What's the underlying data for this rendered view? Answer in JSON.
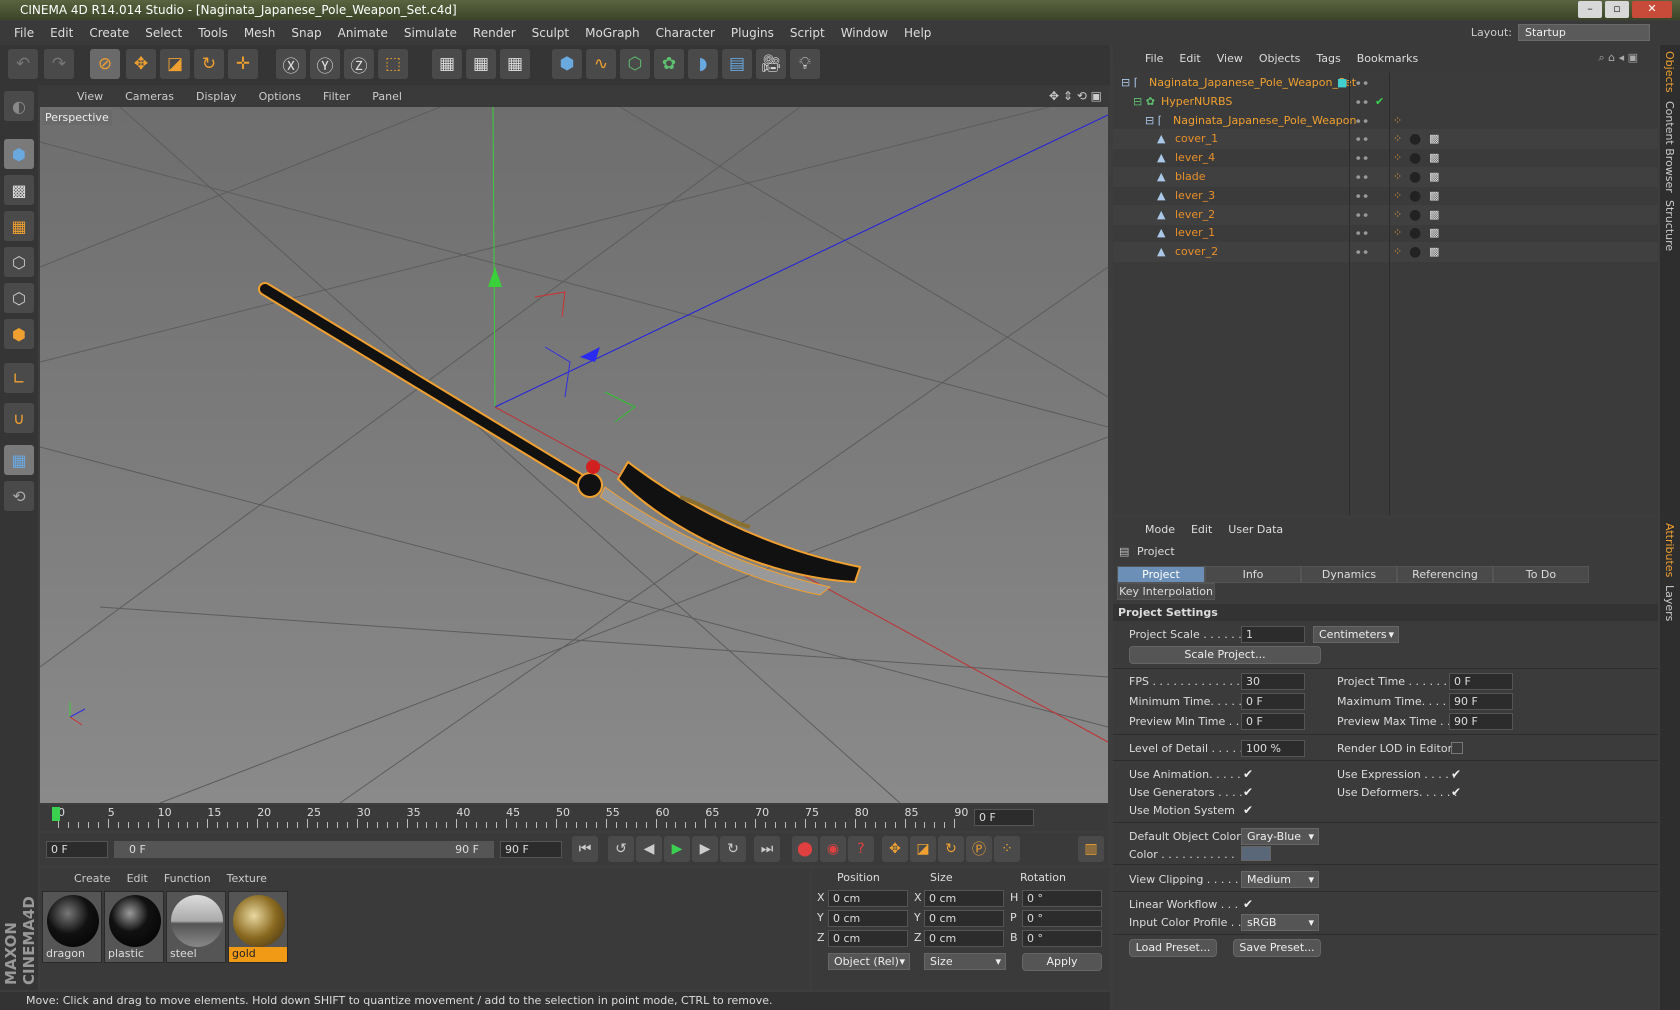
{
  "window": {
    "title": "CINEMA 4D R14.014 Studio - [Naginata_Japanese_Pole_Weapon_Set.c4d]"
  },
  "menubar": {
    "items": [
      "File",
      "Edit",
      "Create",
      "Select",
      "Tools",
      "Mesh",
      "Snap",
      "Animate",
      "Simulate",
      "Render",
      "Sculpt",
      "MoGraph",
      "Character",
      "Plugins",
      "Script",
      "Window",
      "Help"
    ],
    "layout_label": "Layout:",
    "layout_value": "Startup"
  },
  "viewport": {
    "menu": [
      "View",
      "Cameras",
      "Display",
      "Options",
      "Filter",
      "Panel"
    ],
    "label": "Perspective"
  },
  "timeline": {
    "ticks": [
      "0",
      "5",
      "10",
      "15",
      "20",
      "25",
      "30",
      "35",
      "40",
      "45",
      "50",
      "55",
      "60",
      "65",
      "70",
      "75",
      "80",
      "85",
      "90"
    ],
    "frame_field": "0 F"
  },
  "transport": {
    "start": "0 F",
    "range_start": "0 F",
    "range_end": "90 F",
    "end": "90 F"
  },
  "materials": {
    "menu": [
      "Create",
      "Edit",
      "Function",
      "Texture"
    ],
    "items": [
      {
        "name": "dragon",
        "selected": false
      },
      {
        "name": "plastic",
        "selected": false
      },
      {
        "name": "steel",
        "selected": false
      },
      {
        "name": "gold",
        "selected": true
      }
    ]
  },
  "coords": {
    "headers": [
      "Position",
      "Size",
      "Rotation"
    ],
    "pos": [
      "0 cm",
      "0 cm",
      "0 cm"
    ],
    "size": [
      "0 cm",
      "0 cm",
      "0 cm"
    ],
    "rot": [
      "0 °",
      "0 °",
      "0 °"
    ],
    "axes1": [
      "X",
      "Y",
      "Z"
    ],
    "axes2": [
      "X",
      "Y",
      "Z"
    ],
    "axes3": [
      "H",
      "P",
      "B"
    ],
    "mode": "Object (Rel)",
    "size_mode": "Size",
    "apply": "Apply"
  },
  "status": "Move: Click and drag to move elements. Hold down SHIFT to quantize movement / add to the selection in point mode, CTRL to remove.",
  "maxon": "MAXON CINEMA4D",
  "objects": {
    "menu": [
      "File",
      "Edit",
      "View",
      "Objects",
      "Tags",
      "Bookmarks"
    ],
    "tree": [
      {
        "name": "Naginata_Japanese_Pole_Weapon_Set",
        "indent": 0,
        "color": "#f0a030"
      },
      {
        "name": "HyperNURBS",
        "indent": 1,
        "color": "#f0a030"
      },
      {
        "name": "Naginata_Japanese_Pole_Weapon",
        "indent": 2,
        "color": "#f0a030"
      },
      {
        "name": "cover_1",
        "indent": 3,
        "color": "#e8902a"
      },
      {
        "name": "lever_4",
        "indent": 3,
        "color": "#e8902a"
      },
      {
        "name": "blade",
        "indent": 3,
        "color": "#e8902a"
      },
      {
        "name": "lever_3",
        "indent": 3,
        "color": "#e8902a"
      },
      {
        "name": "lever_2",
        "indent": 3,
        "color": "#e8902a"
      },
      {
        "name": "lever_1",
        "indent": 3,
        "color": "#e8902a"
      },
      {
        "name": "cover_2",
        "indent": 3,
        "color": "#e8902a"
      }
    ]
  },
  "attributes": {
    "menu": [
      "Mode",
      "Edit",
      "User Data"
    ],
    "title": "Project",
    "tabs": [
      "Project Settings",
      "Info",
      "Dynamics",
      "Referencing",
      "To Do"
    ],
    "tab2": "Key Interpolation",
    "section": "Project Settings",
    "project_scale_label": "Project Scale . . . . . .",
    "project_scale": "1",
    "unit": "Centimeters",
    "scale_btn": "Scale Project...",
    "fps_label": "FPS . . . . . . . . . . . . . .",
    "fps": "30",
    "ptime_label": "Project Time . . . . . . . .",
    "ptime": "0 F",
    "mintime_label": "Minimum Time. . . . . .",
    "mintime": "0 F",
    "maxtime_label": "Maximum Time. . . . . .",
    "maxtime": "90 F",
    "pmin_label": "Preview Min Time . . .",
    "pmin": "0 F",
    "pmax_label": "Preview Max Time . . .",
    "pmax": "90 F",
    "lod_label": "Level of Detail . . . . .",
    "lod": "100 %",
    "rlod_label": "Render LOD in Editor",
    "anim_label": "Use Animation. . . . .",
    "expr_label": "Use Expression . . . . .",
    "gen_label": "Use Generators . . . .",
    "def_label": "Use Deformers. . . . . .",
    "motion_label": "Use Motion System",
    "doc_label": "Default Object Color",
    "doc": "Gray-Blue",
    "color_label": "Color . . . . . . . . . . .",
    "vclip_label": "View Clipping . . . . .",
    "vclip": "Medium",
    "lw_label": "Linear Workflow . . .",
    "icp_label": "Input Color Profile . .",
    "icp": "sRGB",
    "load": "Load Preset...",
    "save": "Save Preset..."
  },
  "right_tabs": [
    "Objects",
    "Content Browser",
    "Structure",
    "Attributes",
    "Layers"
  ]
}
